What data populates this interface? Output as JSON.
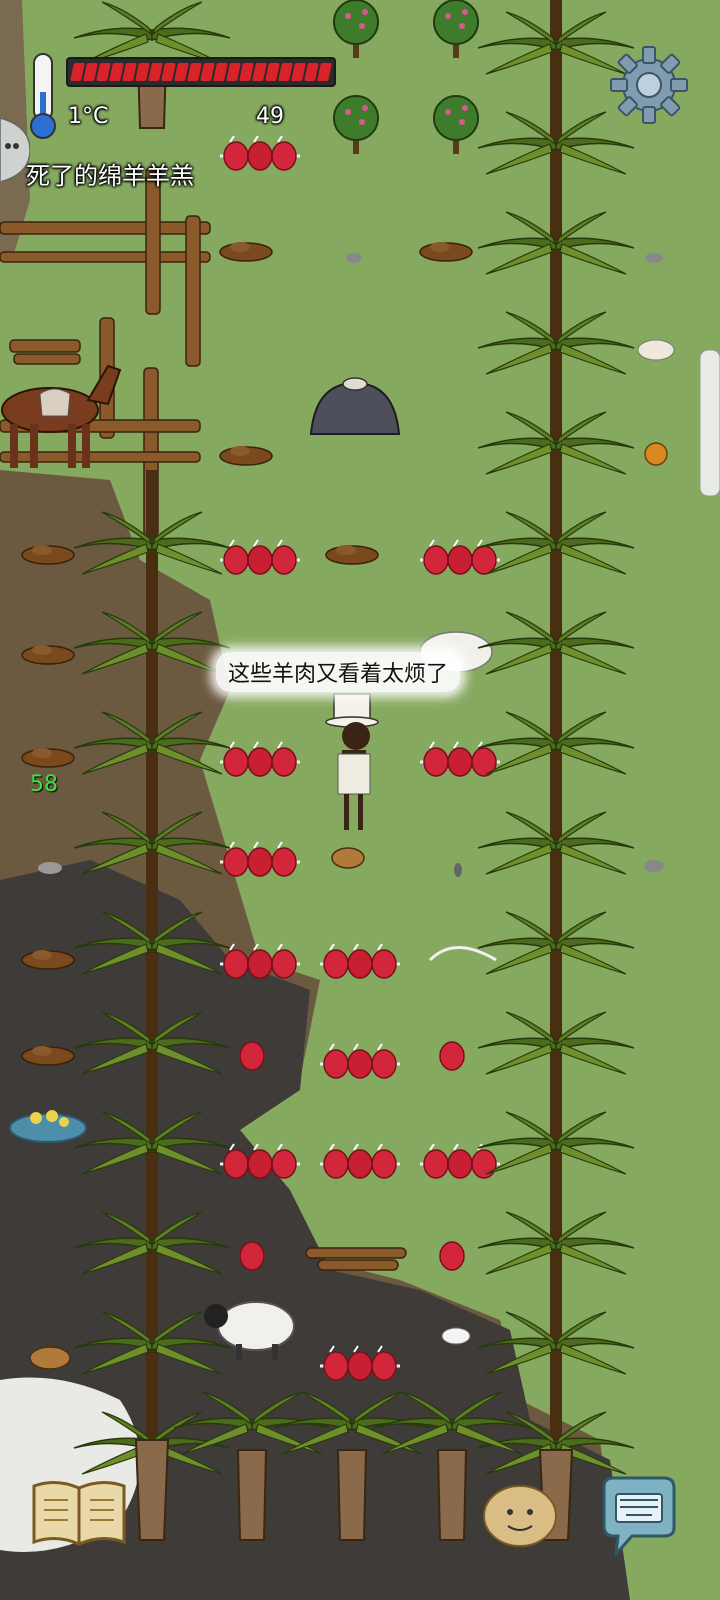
{
  "hud": {
    "temperature": "1°C",
    "age": "49",
    "hover_label": "死了的绵羊羊羔",
    "food_pips_filled": 20,
    "food_pips_total": 20,
    "side_counter": "58"
  },
  "speech": {
    "text": "这些羊肉又看着太烦了"
  },
  "buttons": {
    "settings_icon": "gear-icon",
    "book_icon": "book-icon",
    "emote_icon": "emote-face-icon",
    "keyboard_icon": "keyboard-icon"
  },
  "colors": {
    "food_bar": "#d9232a",
    "grass": "#7fa35a",
    "dirt": "#6b5a40",
    "ash": "#3f3b38",
    "meat": "#d2263a",
    "counter": "#3de33d"
  }
}
